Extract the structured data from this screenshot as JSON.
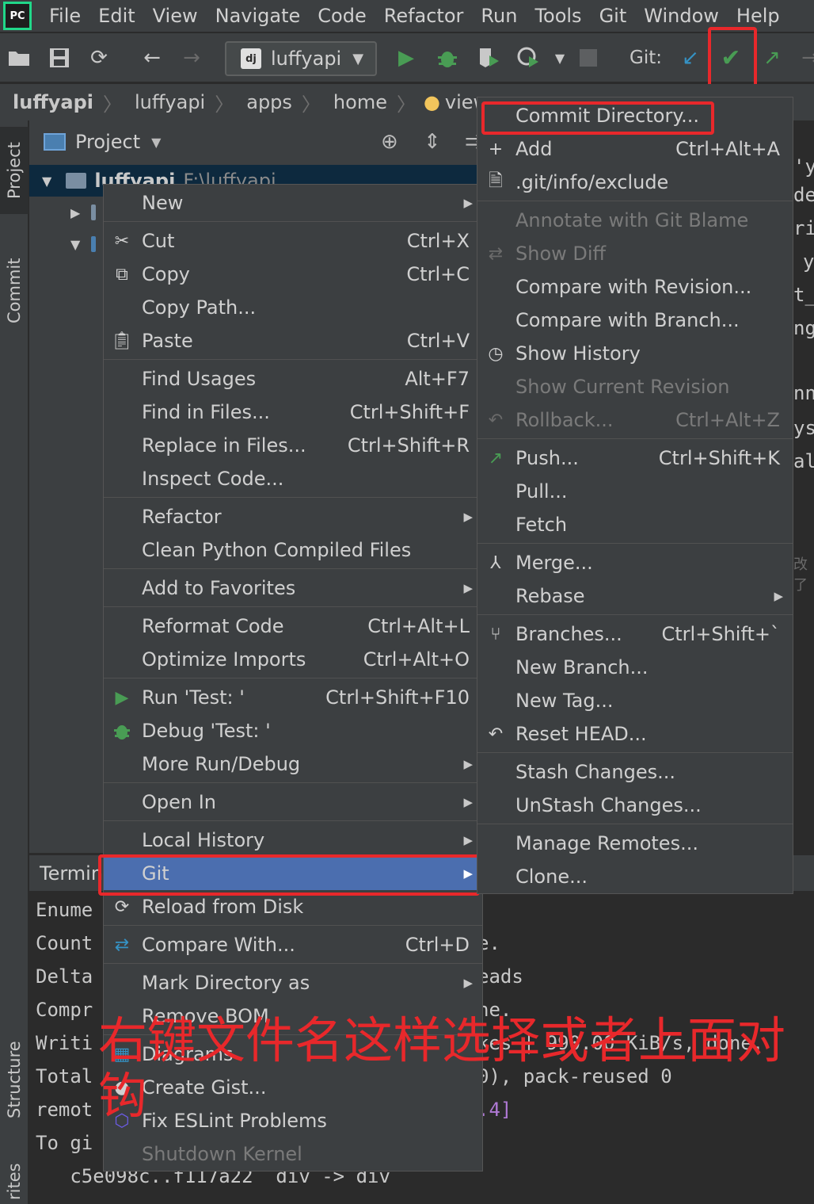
{
  "menubar": {
    "logo_text": "PC",
    "items": [
      "File",
      "Edit",
      "View",
      "Navigate",
      "Code",
      "Refactor",
      "Run",
      "Tools",
      "Git",
      "Window",
      "Help"
    ]
  },
  "toolbar": {
    "run_config": "luffyapi",
    "run_config_badge": "dj",
    "git_label": "Git:"
  },
  "breadcrumb": [
    "luffyapi",
    "luffyapi",
    "apps",
    "home",
    "views.py"
  ],
  "left_strip": {
    "project_tab": "Project",
    "commit_tab": "Commit",
    "structure_tab": "Structure",
    "favorites_tab": "rites"
  },
  "project": {
    "header": "Project",
    "root_name": "luffyapi",
    "root_path": "F:\\luffyapi"
  },
  "editor_fragments": [
    "'y",
    "de",
    "ri",
    "y",
    "t_",
    "ng",
    "nn",
    "ys",
    "al",
    "改了"
  ],
  "terminal": {
    "tab_label": "Termin",
    "lines": [
      "Enume",
      "Count",
      "Delta",
      "Compr",
      "Writi",
      "Total",
      "remot",
      "To gi",
      "   c5e098c..f117a22  div -> div"
    ],
    "right_fragments": [
      "e.",
      "eads",
      "ne.",
      "kes | 990.00 KiB/s, done.",
      "0), pack-reused 0",
      ".4]"
    ]
  },
  "context_menu": {
    "items": [
      {
        "label": "New",
        "shortcut": "",
        "submenu": true
      },
      {
        "label": "Cut",
        "shortcut": "Ctrl+X"
      },
      {
        "label": "Copy",
        "shortcut": "Ctrl+C"
      },
      {
        "label": "Copy Path...",
        "shortcut": ""
      },
      {
        "label": "Paste",
        "shortcut": "Ctrl+V"
      },
      {
        "label": "Find Usages",
        "shortcut": "Alt+F7"
      },
      {
        "label": "Find in Files...",
        "shortcut": "Ctrl+Shift+F"
      },
      {
        "label": "Replace in Files...",
        "shortcut": "Ctrl+Shift+R"
      },
      {
        "label": "Inspect Code...",
        "shortcut": ""
      },
      {
        "label": "Refactor",
        "shortcut": "",
        "submenu": true
      },
      {
        "label": "Clean Python Compiled Files",
        "shortcut": ""
      },
      {
        "label": "Add to Favorites",
        "shortcut": "",
        "submenu": true
      },
      {
        "label": "Reformat Code",
        "shortcut": "Ctrl+Alt+L"
      },
      {
        "label": "Optimize Imports",
        "shortcut": "Ctrl+Alt+O"
      },
      {
        "label": "Run 'Test: '",
        "shortcut": "Ctrl+Shift+F10"
      },
      {
        "label": "Debug 'Test: '",
        "shortcut": ""
      },
      {
        "label": "More Run/Debug",
        "shortcut": "",
        "submenu": true
      },
      {
        "label": "Open In",
        "shortcut": "",
        "submenu": true
      },
      {
        "label": "Local History",
        "shortcut": "",
        "submenu": true
      },
      {
        "label": "Git",
        "shortcut": "",
        "submenu": true
      },
      {
        "label": "Reload from Disk",
        "shortcut": ""
      },
      {
        "label": "Compare With...",
        "shortcut": "Ctrl+D"
      },
      {
        "label": "Mark Directory as",
        "shortcut": "",
        "submenu": true
      },
      {
        "label": "Remove BOM",
        "shortcut": ""
      },
      {
        "label": "Diagrams",
        "shortcut": ""
      },
      {
        "label": "Create Gist...",
        "shortcut": ""
      },
      {
        "label": "Fix ESLint Problems",
        "shortcut": ""
      },
      {
        "label": "Shutdown Kernel",
        "shortcut": ""
      }
    ]
  },
  "git_menu": {
    "items": [
      {
        "label": "Commit Directory...",
        "shortcut": ""
      },
      {
        "label": "Add",
        "shortcut": "Ctrl+Alt+A"
      },
      {
        "label": ".git/info/exclude",
        "shortcut": ""
      },
      {
        "label": "Annotate with Git Blame",
        "shortcut": ""
      },
      {
        "label": "Show Diff",
        "shortcut": ""
      },
      {
        "label": "Compare with Revision...",
        "shortcut": ""
      },
      {
        "label": "Compare with Branch...",
        "shortcut": ""
      },
      {
        "label": "Show History",
        "shortcut": ""
      },
      {
        "label": "Show Current Revision",
        "shortcut": ""
      },
      {
        "label": "Rollback...",
        "shortcut": "Ctrl+Alt+Z"
      },
      {
        "label": "Push...",
        "shortcut": "Ctrl+Shift+K"
      },
      {
        "label": "Pull...",
        "shortcut": ""
      },
      {
        "label": "Fetch",
        "shortcut": ""
      },
      {
        "label": "Merge...",
        "shortcut": ""
      },
      {
        "label": "Rebase",
        "shortcut": "",
        "submenu": true
      },
      {
        "label": "Branches...",
        "shortcut": "Ctrl+Shift+`"
      },
      {
        "label": "New Branch...",
        "shortcut": ""
      },
      {
        "label": "New Tag...",
        "shortcut": ""
      },
      {
        "label": "Reset HEAD...",
        "shortcut": ""
      },
      {
        "label": "Stash Changes...",
        "shortcut": ""
      },
      {
        "label": "UnStash Changes...",
        "shortcut": ""
      },
      {
        "label": "Manage Remotes...",
        "shortcut": ""
      },
      {
        "label": "Clone...",
        "shortcut": ""
      }
    ]
  },
  "annotation": "右键文件名这样选择或者上面对钩",
  "colors": {
    "highlight_red": "#e8282b",
    "selection_blue": "#4b6eaf",
    "run_green": "#499c54",
    "commit_blue": "#3592c4"
  }
}
